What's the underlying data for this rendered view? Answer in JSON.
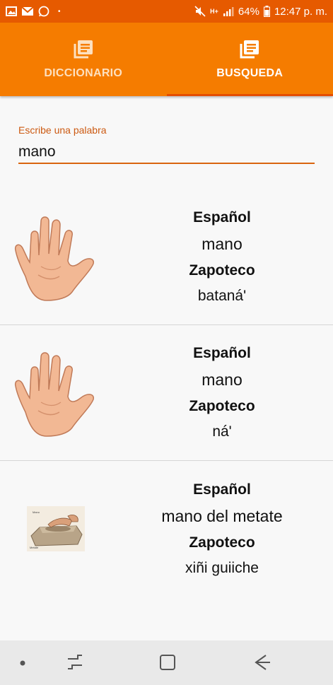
{
  "status_bar": {
    "battery": "64%",
    "time": "12:47 p. m.",
    "network": "H+"
  },
  "tabs": [
    {
      "label": "DICCIONARIO",
      "icon": "book-list-icon",
      "active": false
    },
    {
      "label": "BUSQUEDA",
      "icon": "book-list-icon",
      "active": true
    }
  ],
  "search": {
    "label": "Escribe una palabra",
    "value": "mano"
  },
  "results": [
    {
      "spanish_label": "Español",
      "spanish": "mano",
      "zapotec_label": "Zapoteco",
      "zapotec": "bataná'",
      "image": "hand-image"
    },
    {
      "spanish_label": "Español",
      "spanish": "mano",
      "zapotec_label": "Zapoteco",
      "zapotec": "ná'",
      "image": "hand-image"
    },
    {
      "spanish_label": "Español",
      "spanish": "mano del metate",
      "zapotec_label": "Zapoteco",
      "zapotec": "xiñi guiiche",
      "image": "metate-image"
    }
  ],
  "colors": {
    "header": "#f57c00",
    "status_bar": "#e65a00",
    "accent": "#d9650f"
  }
}
